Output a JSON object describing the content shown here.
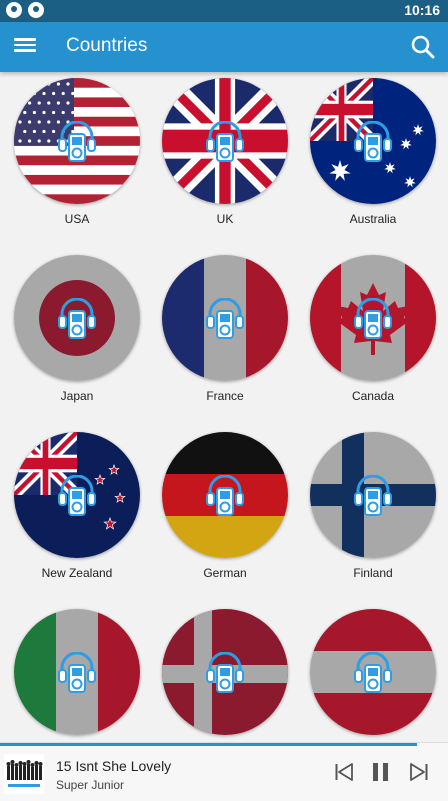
{
  "status_bar": {
    "time": "10:16"
  },
  "app_bar": {
    "title": "Countries"
  },
  "countries": [
    {
      "label": "USA",
      "flag": "usa"
    },
    {
      "label": "UK",
      "flag": "uk"
    },
    {
      "label": "Australia",
      "flag": "australia"
    },
    {
      "label": "Japan",
      "flag": "japan"
    },
    {
      "label": "France",
      "flag": "france"
    },
    {
      "label": "Canada",
      "flag": "canada"
    },
    {
      "label": "New Zealand",
      "flag": "newzealand"
    },
    {
      "label": "German",
      "flag": "germany"
    },
    {
      "label": "Finland",
      "flag": "finland"
    },
    {
      "label": "",
      "flag": "italy"
    },
    {
      "label": "",
      "flag": "denmark"
    },
    {
      "label": "",
      "flag": "austria"
    }
  ],
  "player": {
    "title": "15 Isnt She Lovely",
    "artist": "Super Junior",
    "progress": 0.93
  },
  "colors": {
    "app_bar": "#2591cf",
    "status_bar": "#1b5f84",
    "icon_blue": "#2d9de6"
  }
}
